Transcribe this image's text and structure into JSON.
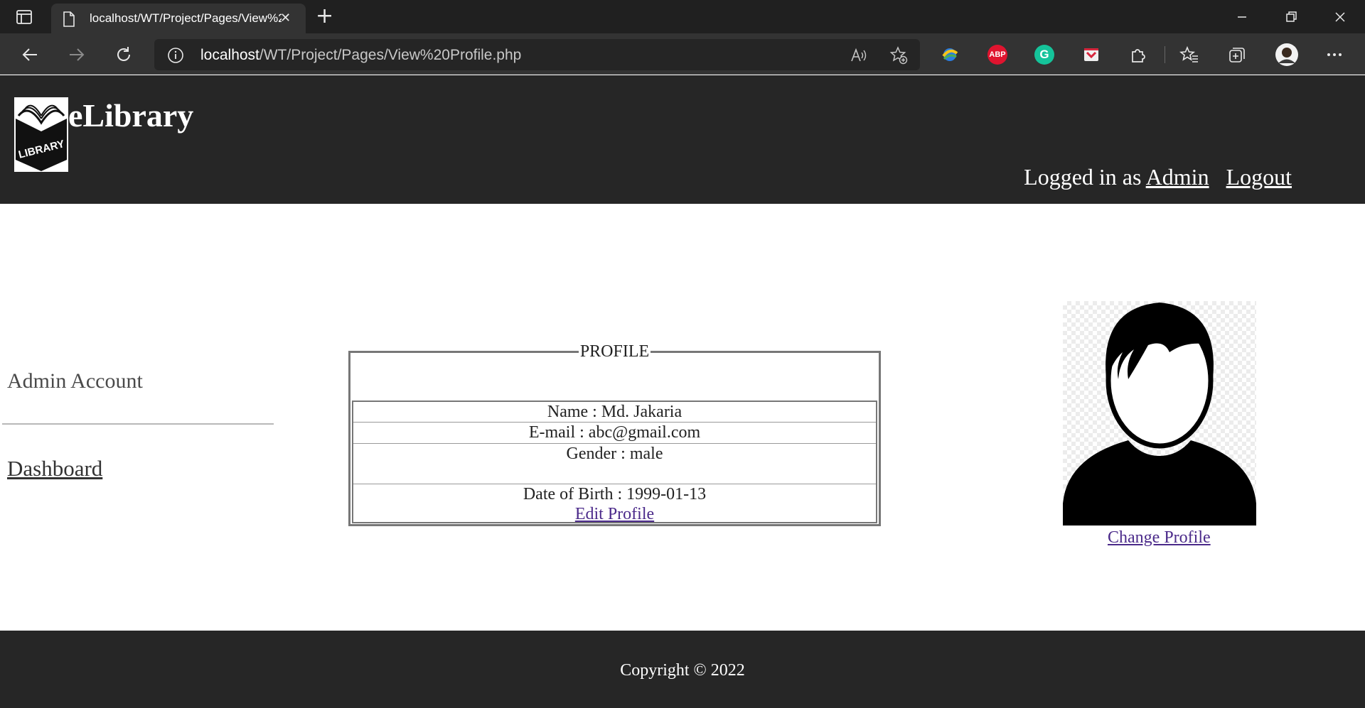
{
  "browser": {
    "tab_title": "localhost/WT/Project/Pages/View%20Profile.php",
    "url_host": "localhost",
    "url_path": "/WT/Project/Pages/View%20Profile.php",
    "extensions": [
      "edge-extension-icon",
      "adblock-plus-icon",
      "grammarly-icon",
      "pocket-icon"
    ],
    "abp_label": "ABP",
    "grammarly_label": "G"
  },
  "header": {
    "brand": "eLibrary",
    "logo_text": "LIBRARY",
    "logged_in_prefix": "Logged in as",
    "user_link": "Admin",
    "logout_link": "Logout"
  },
  "sidebar": {
    "title": "Admin Account",
    "links": [
      {
        "label": "Dashboard"
      }
    ]
  },
  "profile": {
    "legend": "PROFILE",
    "name": "Name : Md. Jakaria",
    "email": "E-mail : abc@gmail.com",
    "gender": "Gender : male",
    "dob": "Date of Birth : 1999-01-13",
    "edit_link": "Edit Profile"
  },
  "avatar": {
    "change_link": "Change Profile"
  },
  "footer": {
    "copyright": "Copyright © 2022"
  },
  "colors": {
    "header_bg": "#262626",
    "link_visited": "#4b2a8a"
  }
}
